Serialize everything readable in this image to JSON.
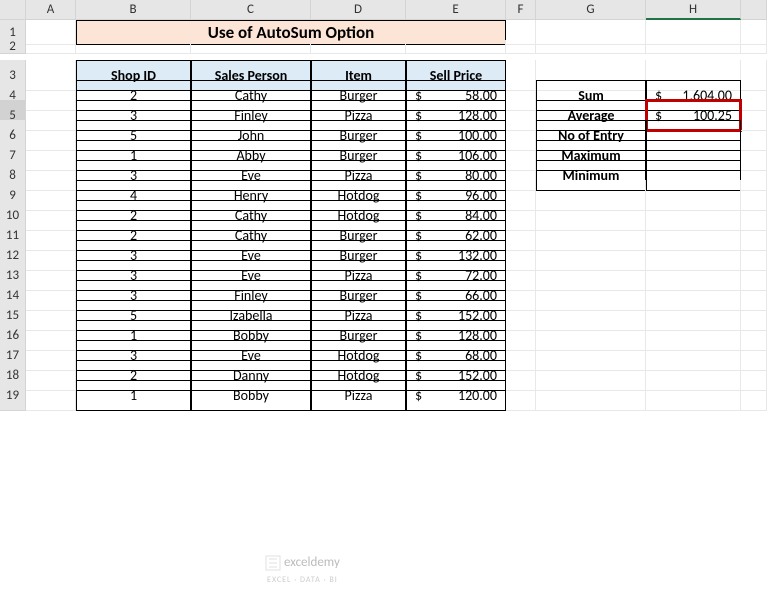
{
  "columns": [
    "",
    "A",
    "B",
    "C",
    "D",
    "E",
    "F",
    "G",
    "H",
    ""
  ],
  "rows": [
    "1",
    "2",
    "3",
    "4",
    "5",
    "6",
    "7",
    "8",
    "9",
    "10",
    "11",
    "12",
    "13",
    "14",
    "15",
    "16",
    "17",
    "18",
    "19"
  ],
  "title": "Use of AutoSum Option",
  "table": {
    "headers": [
      "Shop ID",
      "Sales Person",
      "Item",
      "Sell Price"
    ],
    "data": [
      {
        "id": "2",
        "person": "Cathy",
        "item": "Burger",
        "price": "58.00"
      },
      {
        "id": "3",
        "person": "Finley",
        "item": "Pizza",
        "price": "128.00"
      },
      {
        "id": "5",
        "person": "John",
        "item": "Burger",
        "price": "100.00"
      },
      {
        "id": "1",
        "person": "Abby",
        "item": "Burger",
        "price": "106.00"
      },
      {
        "id": "3",
        "person": "Eve",
        "item": "Pizza",
        "price": "80.00"
      },
      {
        "id": "4",
        "person": "Henry",
        "item": "Hotdog",
        "price": "96.00"
      },
      {
        "id": "2",
        "person": "Cathy",
        "item": "Hotdog",
        "price": "84.00"
      },
      {
        "id": "2",
        "person": "Cathy",
        "item": "Burger",
        "price": "62.00"
      },
      {
        "id": "3",
        "person": "Eve",
        "item": "Burger",
        "price": "132.00"
      },
      {
        "id": "3",
        "person": "Eve",
        "item": "Pizza",
        "price": "72.00"
      },
      {
        "id": "3",
        "person": "Finley",
        "item": "Burger",
        "price": "66.00"
      },
      {
        "id": "5",
        "person": "Izabella",
        "item": "Pizza",
        "price": "152.00"
      },
      {
        "id": "1",
        "person": "Bobby",
        "item": "Burger",
        "price": "128.00"
      },
      {
        "id": "3",
        "person": "Eve",
        "item": "Hotdog",
        "price": "68.00"
      },
      {
        "id": "2",
        "person": "Danny",
        "item": "Hotdog",
        "price": "152.00"
      },
      {
        "id": "1",
        "person": "Bobby",
        "item": "Pizza",
        "price": "120.00"
      }
    ]
  },
  "summary": [
    {
      "label": "Sum",
      "sym": "$",
      "val": "1,604.00"
    },
    {
      "label": "Average",
      "sym": "$",
      "val": "100.25"
    },
    {
      "label": "No of Entry",
      "sym": "",
      "val": ""
    },
    {
      "label": "Maximum",
      "sym": "",
      "val": ""
    },
    {
      "label": "Minimum",
      "sym": "",
      "val": ""
    }
  ],
  "currency": "$",
  "watermark": {
    "brand": "exceldemy",
    "tag": "EXCEL · DATA · BI"
  }
}
